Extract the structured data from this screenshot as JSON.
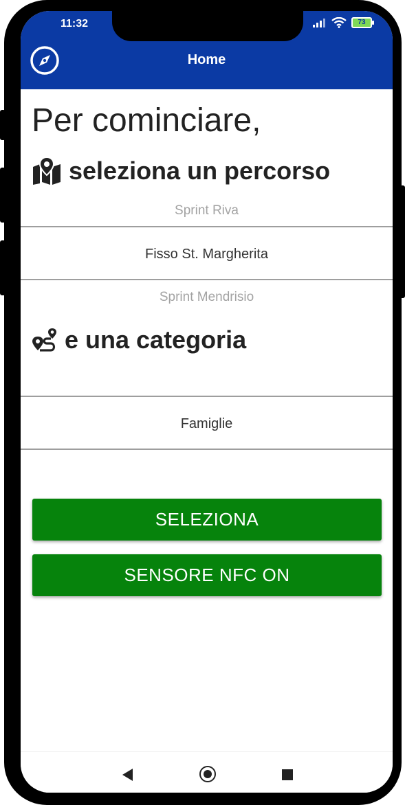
{
  "status_bar": {
    "time": "11:32",
    "battery": "73"
  },
  "app_bar": {
    "title": "Home",
    "icons": [
      "compass-icon"
    ]
  },
  "main": {
    "heading": "Per cominciare,",
    "route_heading": "seleziona un percorso",
    "route_picker": {
      "options": [
        "Sprint Riva",
        "Fisso St. Margherita",
        "Sprint Mendrisio"
      ],
      "selected": "Fisso St. Margherita"
    },
    "category_heading": "e una categoria",
    "category_picker": {
      "options": [
        "Famiglie"
      ],
      "selected": "Famiglie"
    },
    "select_button": "SELEZIONA",
    "nfc_button": "SENSORE NFC ON"
  },
  "colors": {
    "app_bar": "#0b3aa4",
    "button": "#06830c"
  },
  "nav_bar": {
    "icons": [
      "back-icon",
      "home-icon",
      "recents-icon"
    ]
  }
}
